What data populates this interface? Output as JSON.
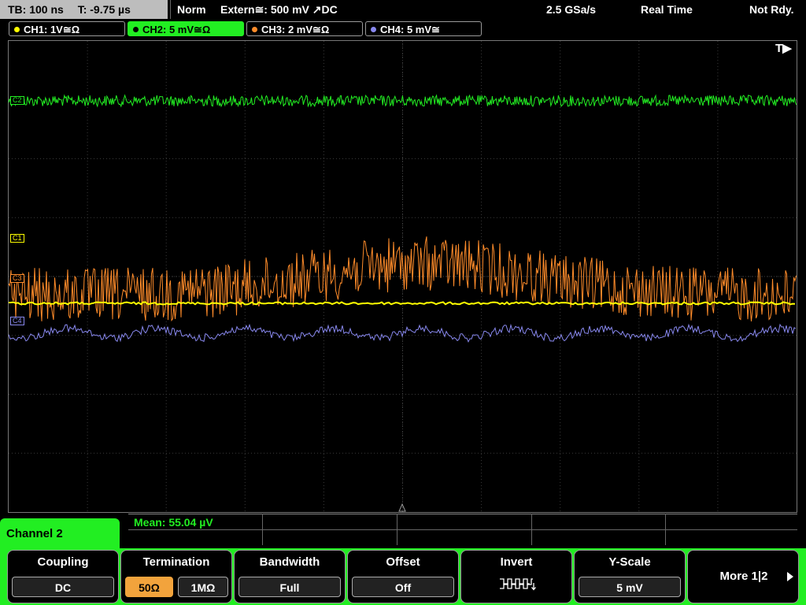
{
  "status_bar": {
    "timebase": "TB: 100 ns",
    "trigger_time": "T: -9.75 µs",
    "mode": "Norm",
    "trigger_source": "Extern≅: 500 mV ↗DC",
    "sample_rate": "2.5 GSa/s",
    "acq_mode": "Real Time",
    "state": "Not Rdy."
  },
  "channels": [
    {
      "label": "CH1: 1V≅Ω",
      "color": "#ffff00"
    },
    {
      "label": "CH2: 5 mV≅Ω",
      "color": "#22ee22",
      "active": true
    },
    {
      "label": "CH3: 2 mV≅Ω",
      "color": "#ff8c2a"
    },
    {
      "label": "CH4: 5 mV≅",
      "color": "#8888ee"
    }
  ],
  "trace_markers": {
    "c2": "C2",
    "c1": "C1",
    "c3": "C3",
    "c4": "C4",
    "trigger": "T▶"
  },
  "measurement": {
    "label": "Mean: 55.04 µV"
  },
  "menu": {
    "title": "Channel 2",
    "coupling": {
      "title": "Coupling",
      "value": "DC"
    },
    "termination": {
      "title": "Termination",
      "opt1": "50Ω",
      "opt2": "1MΩ"
    },
    "bandwidth": {
      "title": "Bandwidth",
      "value": "Full"
    },
    "offset": {
      "title": "Offset",
      "value": "Off"
    },
    "invert": {
      "title": "Invert",
      "icon": "invert-waveform-icon"
    },
    "yscale": {
      "title": "Y-Scale",
      "value": "5 mV"
    },
    "more": {
      "label": "More 1|2"
    }
  },
  "colors": {
    "ch1": "#ffff00",
    "ch2": "#22ee22",
    "ch3": "#ff8c2a",
    "ch4": "#8888ee",
    "menu": "#22ee22",
    "selected": "#f2a33c"
  }
}
